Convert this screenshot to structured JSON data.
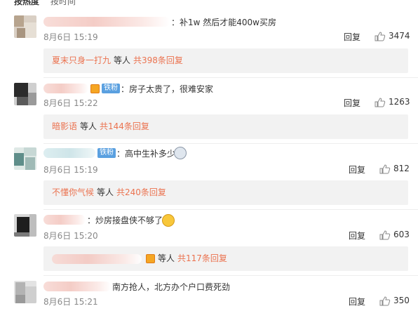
{
  "sort": {
    "hot": "按热度",
    "time": "按时间"
  },
  "comments": [
    {
      "text": "：补1w 然后才能400w买房",
      "time": "8月6日 15:19",
      "reply": "回复",
      "likes": "3474",
      "subreply": {
        "who": "夏末只身一打九",
        "mid": "等人",
        "count": "共398条回复"
      }
    },
    {
      "badge": "铁粉",
      "text": "：房子太贵了，很难安家",
      "time": "8月6日 15:22",
      "reply": "回复",
      "likes": "1263",
      "subreply": {
        "who": "暗影语",
        "mid": "等人",
        "count": "共144条回复"
      }
    },
    {
      "badge": "铁粉",
      "text": "：高中生补多少",
      "time": "8月6日 15:19",
      "reply": "回复",
      "likes": "812",
      "subreply": {
        "who": "不懂你气候",
        "mid": "等人",
        "count": "共240条回复"
      }
    },
    {
      "text": "：炒房接盘侠不够了",
      "time": "8月6日 15:20",
      "reply": "回复",
      "likes": "603",
      "subreply": {
        "who": "",
        "mid": "等人",
        "count": "共117条回复"
      }
    },
    {
      "text": "南方抢人，北方办个户口费死劲",
      "time": "8月6日 15:21",
      "reply": "回复",
      "likes": "350"
    }
  ]
}
